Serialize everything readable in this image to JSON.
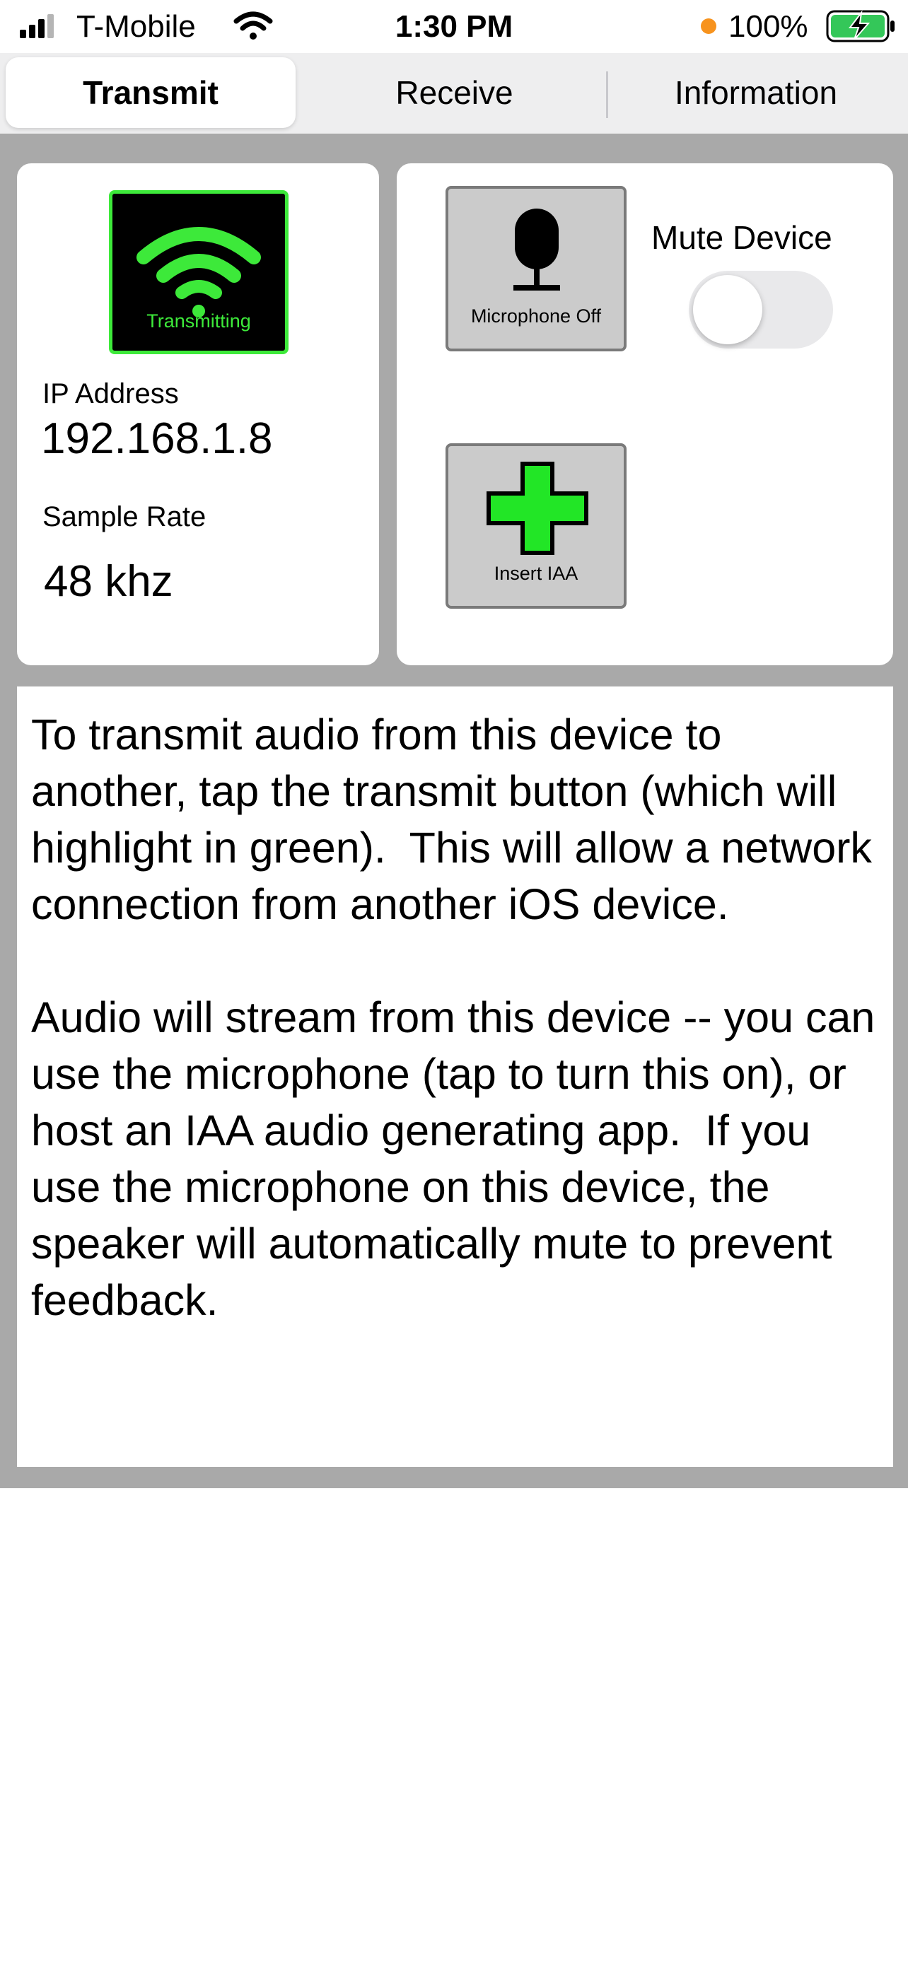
{
  "status_bar": {
    "carrier": "T-Mobile",
    "time": "1:30 PM",
    "battery": "100%",
    "icons": [
      "cellular-signal-icon",
      "wifi-icon",
      "recording-dot-icon",
      "battery-charging-icon"
    ]
  },
  "tabs": [
    {
      "label": "Transmit",
      "selected": true
    },
    {
      "label": "Receive",
      "selected": false
    },
    {
      "label": "Information",
      "selected": false
    }
  ],
  "transmit_card": {
    "button_label": "Transmitting",
    "button_icon": "wifi-broadcast-icon",
    "ip_label": "IP Address",
    "ip_value": "192.168.1.8",
    "rate_label": "Sample Rate",
    "rate_value": "48 khz"
  },
  "controls_card": {
    "microphone_label": "Microphone Off",
    "microphone_icon": "microphone-icon",
    "mute_label": "Mute Device",
    "mute_on": false,
    "iaa_label": "Insert IAA",
    "iaa_icon": "plus-icon"
  },
  "info_text": "To transmit audio from this device to another, tap the transmit button (which will highlight in green).  This will allow a network connection from another iOS device.\n\nAudio will stream from this device -- you can use the microphone (tap to turn this on), or host an IAA audio generating app.  If you use the microphone on this device, the speaker will automatically mute to prevent feedback.",
  "colors": {
    "accent_green": "#3de93a",
    "background_gray": "#a9a9a9",
    "button_gray": "#cbcbcb"
  }
}
